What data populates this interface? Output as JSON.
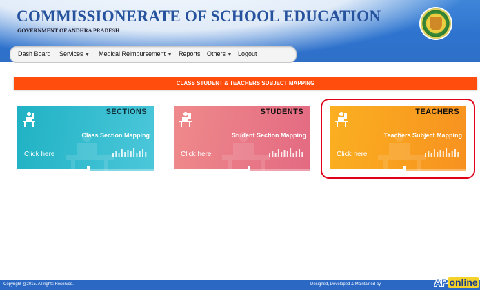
{
  "header": {
    "title": "COMMISSIONERATE OF SCHOOL EDUCATION",
    "subtitle": "GOVERNMENT OF ANDHRA PRADESH",
    "emblem_icon": "state-emblem"
  },
  "nav": {
    "items": [
      {
        "label": "Dash Board",
        "dropdown": false
      },
      {
        "label": "Services",
        "dropdown": true
      },
      {
        "label": "Medical Reimbursement",
        "dropdown": true
      },
      {
        "label": "Reports",
        "dropdown": false
      },
      {
        "label": "Others",
        "dropdown": true
      },
      {
        "label": "Logout",
        "dropdown": false
      }
    ],
    "caret": "▼"
  },
  "banner": {
    "text": "CLASS STUDENT & TEACHERS SUBJECT MAPPING",
    "color": "#ff4d0d"
  },
  "cards": [
    {
      "title": "SECTIONS",
      "subtitle": "Class Section Mapping",
      "link": "Click here",
      "icon": "teacher-desk-icon",
      "progress": 0.52,
      "color": "#1fb2c4"
    },
    {
      "title": "STUDENTS",
      "subtitle": "Student Section Mapping",
      "link": "Click here",
      "icon": "teacher-desk-icon",
      "progress": 0.55,
      "color": "#e36a82"
    },
    {
      "title": "TEACHERS",
      "subtitle": "Teachers Subject Mapping",
      "link": "Click here",
      "icon": "teacher-desk-icon",
      "progress": 0.55,
      "color": "#f79120"
    }
  ],
  "highlight_color": "#e0001a",
  "footer": {
    "copyright": "Copyright @2015. All rights Reserved.",
    "designed": "Designed, Developed & Maintained by",
    "logo": {
      "ap": "AP",
      "online": "online"
    }
  }
}
